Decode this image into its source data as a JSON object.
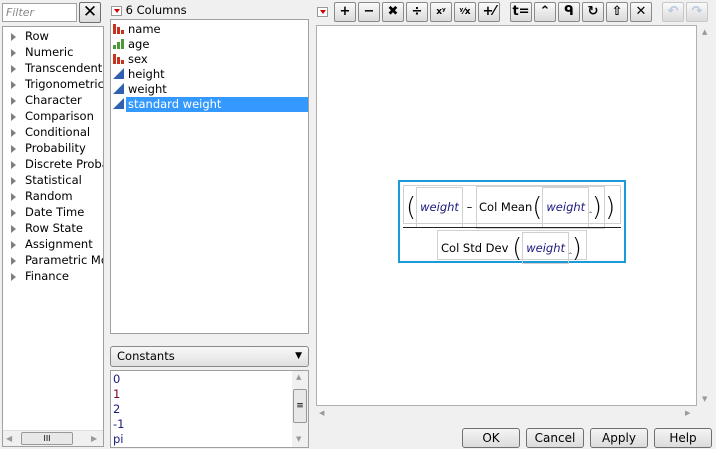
{
  "filter": {
    "placeholder": "Filter"
  },
  "functions": [
    "Row",
    "Numeric",
    "Transcendental",
    "Trigonometric",
    "Character",
    "Comparison",
    "Conditional",
    "Probability",
    "Discrete Probability",
    "Statistical",
    "Random",
    "Date Time",
    "Row State",
    "Assignment",
    "Parametric Model",
    "Finance"
  ],
  "columns": {
    "header": "6 Columns",
    "items": [
      {
        "label": "name",
        "type": "nominal"
      },
      {
        "label": "age",
        "type": "ordinal"
      },
      {
        "label": "sex",
        "type": "nominal"
      },
      {
        "label": "height",
        "type": "continuous"
      },
      {
        "label": "weight",
        "type": "continuous"
      },
      {
        "label": "standard weight",
        "type": "continuous",
        "selected": true
      }
    ]
  },
  "constants": {
    "selected": "Constants",
    "items": [
      "0",
      "1",
      "2",
      "-1",
      "pi"
    ]
  },
  "toolbar": [
    "+",
    "−",
    "✖",
    "÷",
    "xʸ",
    "ʸ⁄x",
    "+⁄−",
    "t=",
    "⌃",
    "ᑫ",
    "↻",
    "⇧",
    "✕",
    "↶",
    "↷"
  ],
  "formula": {
    "var": "weight",
    "minus": "–",
    "col_mean": "Col Mean",
    "col_std_dev": "Col Std Dev"
  },
  "buttons": {
    "ok": "OK",
    "cancel": "Cancel",
    "apply": "Apply",
    "help": "Help"
  },
  "colors": {
    "selection": "#3399ff",
    "formula_border": "#1a9bd7"
  }
}
